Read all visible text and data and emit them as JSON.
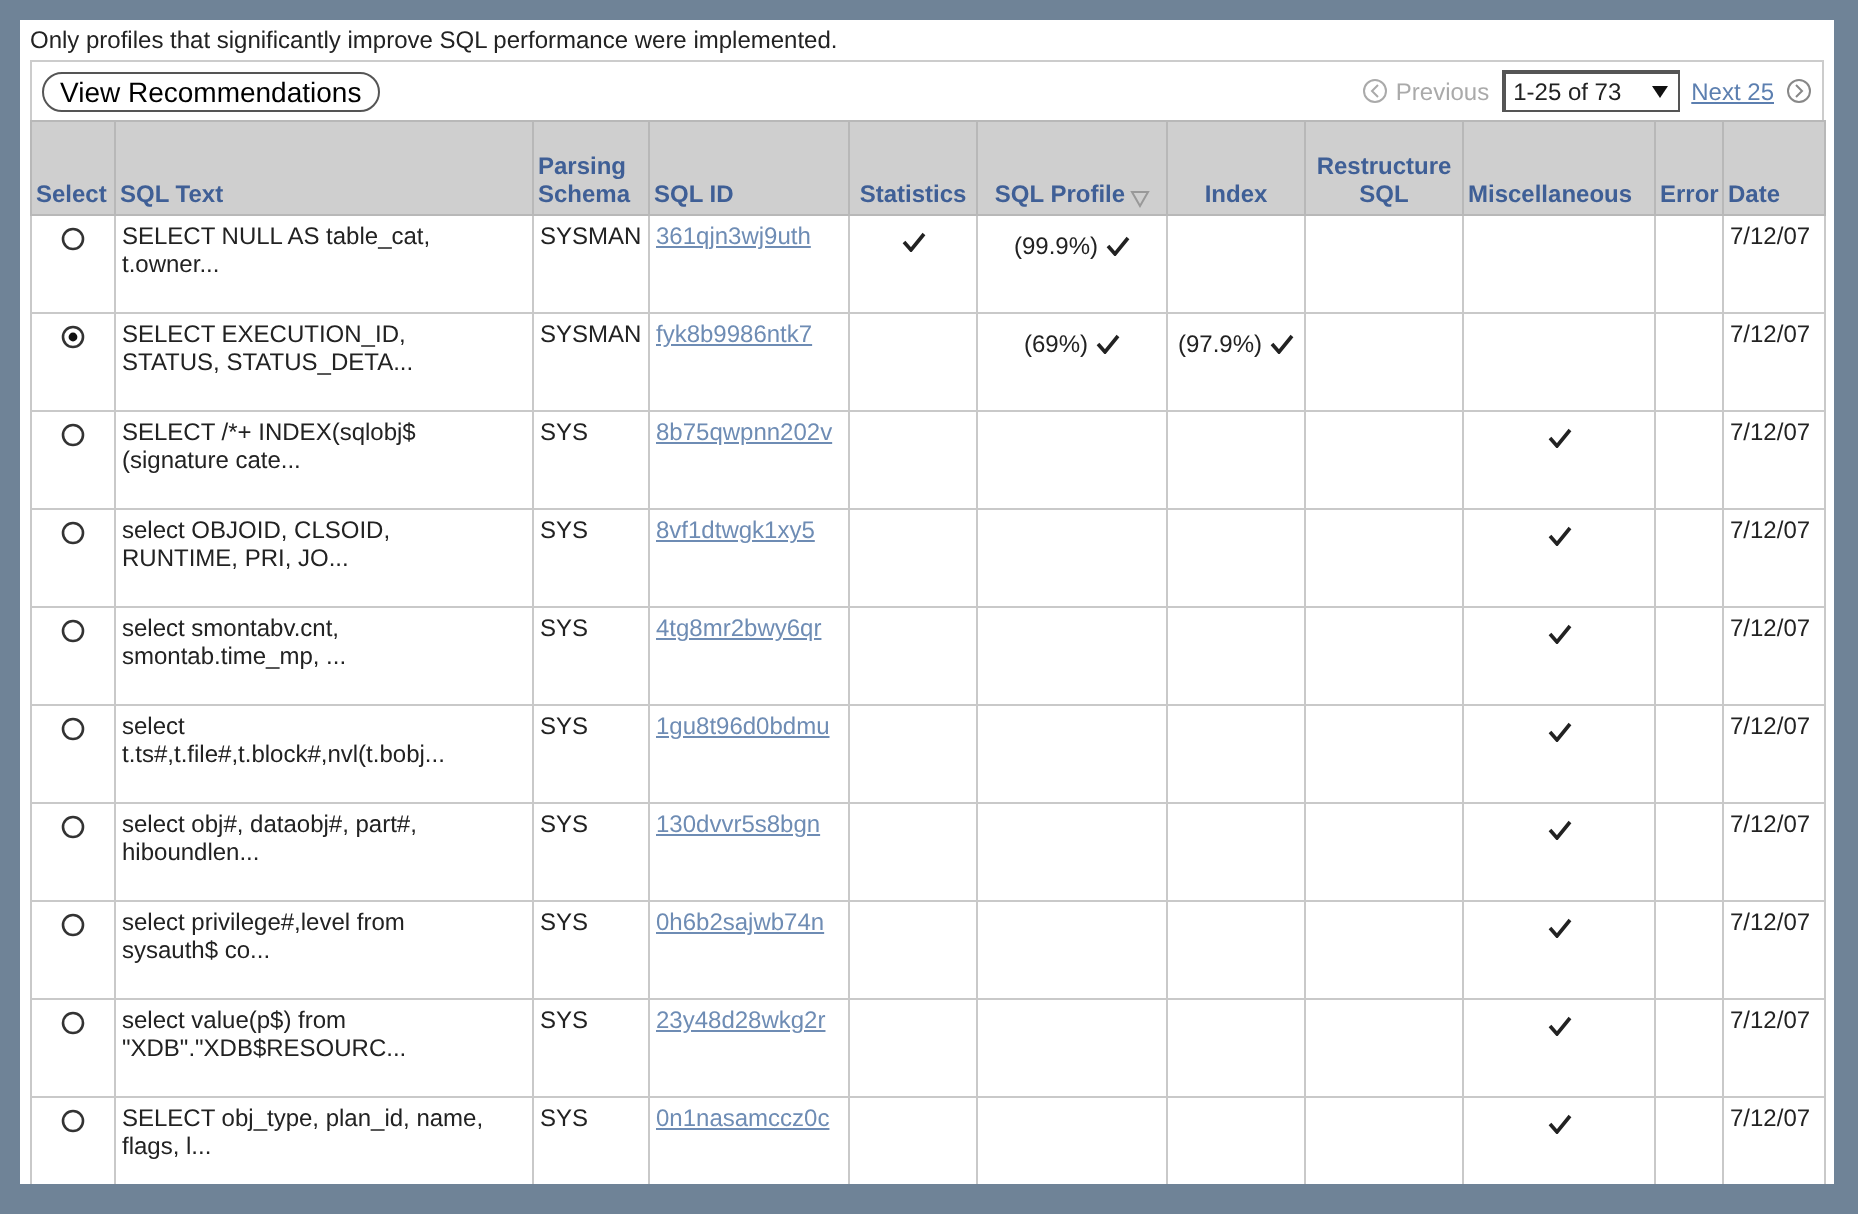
{
  "notice": "Only profiles that significantly improve SQL performance were implemented.",
  "toolbar": {
    "button": "View Recommendations",
    "previous": "Previous",
    "range": "1-25 of 73",
    "next": "Next 25"
  },
  "columns": [
    {
      "label": "Select",
      "kind": "plain",
      "sorted": false
    },
    {
      "label": "SQL Text",
      "kind": "plain",
      "sorted": false
    },
    {
      "label": "Parsing Schema",
      "kind": "plain",
      "sorted": false
    },
    {
      "label": "SQL ID",
      "kind": "plain",
      "sorted": false
    },
    {
      "label": "Statistics",
      "kind": "plain",
      "sorted": false
    },
    {
      "label": "SQL Profile",
      "kind": "plain",
      "sorted": true
    },
    {
      "label": "Index",
      "kind": "plain",
      "sorted": false
    },
    {
      "label": "Restructure SQL",
      "kind": "plain",
      "sorted": false
    },
    {
      "label": "Miscellaneous",
      "kind": "plain",
      "sorted": false
    },
    {
      "label": "Error",
      "kind": "plain",
      "sorted": false
    },
    {
      "label": "Date",
      "kind": "plain",
      "sorted": false
    }
  ],
  "rows": [
    {
      "selected": false,
      "sql_text": [
        "SELECT NULL AS table_cat,",
        "t.owner..."
      ],
      "schema": "SYSMAN",
      "sql_id": "361qjn3wj9uth",
      "statistics": {
        "checked": true
      },
      "sql_profile": {
        "checked": true,
        "note": "(99.9%)"
      },
      "index": {
        "checked": false
      },
      "restructure": {
        "checked": false
      },
      "misc": {
        "checked": false
      },
      "date": "7/12/07"
    },
    {
      "selected": true,
      "sql_text": [
        "SELECT EXECUTION_ID,",
        "STATUS, STATUS_DETA..."
      ],
      "schema": "SYSMAN",
      "sql_id": "fyk8b9986ntk7",
      "statistics": {
        "checked": false
      },
      "sql_profile": {
        "checked": true,
        "note": "(69%)"
      },
      "index": {
        "checked": true,
        "note": "(97.9%)"
      },
      "restructure": {
        "checked": false
      },
      "misc": {
        "checked": false
      },
      "date": "7/12/07"
    },
    {
      "selected": false,
      "sql_text": [
        "SELECT /*+ INDEX(sqlobj$",
        "(signature cate..."
      ],
      "schema": "SYS",
      "sql_id": "8b75qwpnn202v",
      "statistics": {
        "checked": false
      },
      "sql_profile": {
        "checked": false
      },
      "index": {
        "checked": false
      },
      "restructure": {
        "checked": false
      },
      "misc": {
        "checked": true
      },
      "date": "7/12/07"
    },
    {
      "selected": false,
      "sql_text": [
        "select OBJOID, CLSOID,",
        "RUNTIME, PRI, JO..."
      ],
      "schema": "SYS",
      "sql_id": "8vf1dtwgk1xy5",
      "statistics": {
        "checked": false
      },
      "sql_profile": {
        "checked": false
      },
      "index": {
        "checked": false
      },
      "restructure": {
        "checked": false
      },
      "misc": {
        "checked": true
      },
      "date": "7/12/07"
    },
    {
      "selected": false,
      "sql_text": [
        "select smontabv.cnt,",
        "smontab.time_mp, ..."
      ],
      "schema": "SYS",
      "sql_id": "4tg8mr2bwy6qr",
      "statistics": {
        "checked": false
      },
      "sql_profile": {
        "checked": false
      },
      "index": {
        "checked": false
      },
      "restructure": {
        "checked": false
      },
      "misc": {
        "checked": true
      },
      "date": "7/12/07"
    },
    {
      "selected": false,
      "sql_text": [
        "select",
        "t.ts#,t.file#,t.block#,nvl(t.bobj..."
      ],
      "schema": "SYS",
      "sql_id": "1gu8t96d0bdmu",
      "statistics": {
        "checked": false
      },
      "sql_profile": {
        "checked": false
      },
      "index": {
        "checked": false
      },
      "restructure": {
        "checked": false
      },
      "misc": {
        "checked": true
      },
      "date": "7/12/07"
    },
    {
      "selected": false,
      "sql_text": [
        "select obj#, dataobj#, part#,",
        "hiboundlen..."
      ],
      "schema": "SYS",
      "sql_id": "130dvvr5s8bgn",
      "statistics": {
        "checked": false
      },
      "sql_profile": {
        "checked": false
      },
      "index": {
        "checked": false
      },
      "restructure": {
        "checked": false
      },
      "misc": {
        "checked": true
      },
      "date": "7/12/07"
    },
    {
      "selected": false,
      "sql_text": [
        "select privilege#,level from",
        "sysauth$ co..."
      ],
      "schema": "SYS",
      "sql_id": "0h6b2sajwb74n",
      "statistics": {
        "checked": false
      },
      "sql_profile": {
        "checked": false
      },
      "index": {
        "checked": false
      },
      "restructure": {
        "checked": false
      },
      "misc": {
        "checked": true
      },
      "date": "7/12/07"
    },
    {
      "selected": false,
      "sql_text": [
        "select value(p$) from",
        "\"XDB\".\"XDB$RESOURC..."
      ],
      "schema": "SYS",
      "sql_id": "23y48d28wkg2r",
      "statistics": {
        "checked": false
      },
      "sql_profile": {
        "checked": false
      },
      "index": {
        "checked": false
      },
      "restructure": {
        "checked": false
      },
      "misc": {
        "checked": true
      },
      "date": "7/12/07"
    },
    {
      "selected": false,
      "sql_text": [
        "SELECT obj_type, plan_id, name,",
        "flags, l..."
      ],
      "schema": "SYS",
      "sql_id": "0n1nasamccz0c",
      "statistics": {
        "checked": false
      },
      "sql_profile": {
        "checked": false
      },
      "index": {
        "checked": false
      },
      "restructure": {
        "checked": false
      },
      "misc": {
        "checked": true
      },
      "date": "7/12/07"
    }
  ]
}
